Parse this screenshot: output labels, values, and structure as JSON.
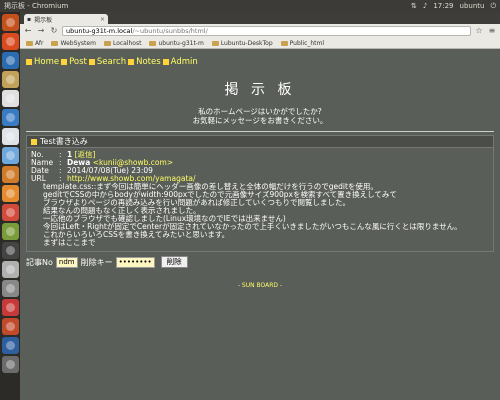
{
  "top_panel": {
    "title": "掲示板 - Chromium",
    "time": "17:29",
    "user": "ubuntu"
  },
  "browser": {
    "tab_title": "掲示板",
    "url_host": "ubuntu-g31t-m.local",
    "url_path": "/~ubuntu/sunbbs/html/",
    "bookmarks": [
      "Afr",
      "WebSystem",
      "Localhost",
      "ubuntu-g31t-m",
      "Lubuntu-DeskTop",
      "Public_html"
    ]
  },
  "nav": {
    "home": "Home",
    "post": "Post",
    "search": "Search",
    "notes": "Notes",
    "admin": "Admin"
  },
  "board": {
    "title": "掲 示 板",
    "subtitle_1": "私のホームページはいかがでしたか?",
    "subtitle_2": "お気軽にメッセージをお書きください。"
  },
  "post": {
    "heading": "Test書き込み",
    "no_label": "No.",
    "no_value": "1",
    "reply": "[返信]",
    "name_label": "Name",
    "name_value": "Dewa",
    "email": "<kunii@showb.com>",
    "date_label": "Date",
    "date_value": "2014/07/08(Tue) 23:09",
    "url_label": "URL",
    "url_value": "http://www.showb.com/yamagata/",
    "lines": [
      "template.css::まず今回は簡単にヘッダー画像の差し替えと全体の幅だけを行うのでgeditを使用。",
      "geditでCSSの中からbodyがwidth:900pxでしたので元画像サイズ900pxを検索すべて置き換えしてみて",
      "ブラウザよりページの再読み込みを行い問題があれば修正していくつもりで閲覧しました。",
      "結果なんの問題もなく正しく表示されました。",
      "一応他のブラウザでも確認しました(Linux環境なのでIEでは出来ません)",
      "今回はLeft・Rightが固定でCenterが固定されていなかったので上手くいきましたがいつもこんな風に行くとは限りません。",
      "これからいろいろCSSを書き換えてみたいと思います。",
      "まずはここまで"
    ]
  },
  "delete_form": {
    "no_label": "記事No",
    "no_value": "ndm",
    "key_label": "削除キー",
    "key_value": "••••••••",
    "button": "削除"
  },
  "footer": {
    "text": "- SUN BOARD -"
  },
  "colors": {
    "page_bg": "#5a5e58",
    "link": "#ffff66",
    "accent_square": "#ffd43b"
  }
}
